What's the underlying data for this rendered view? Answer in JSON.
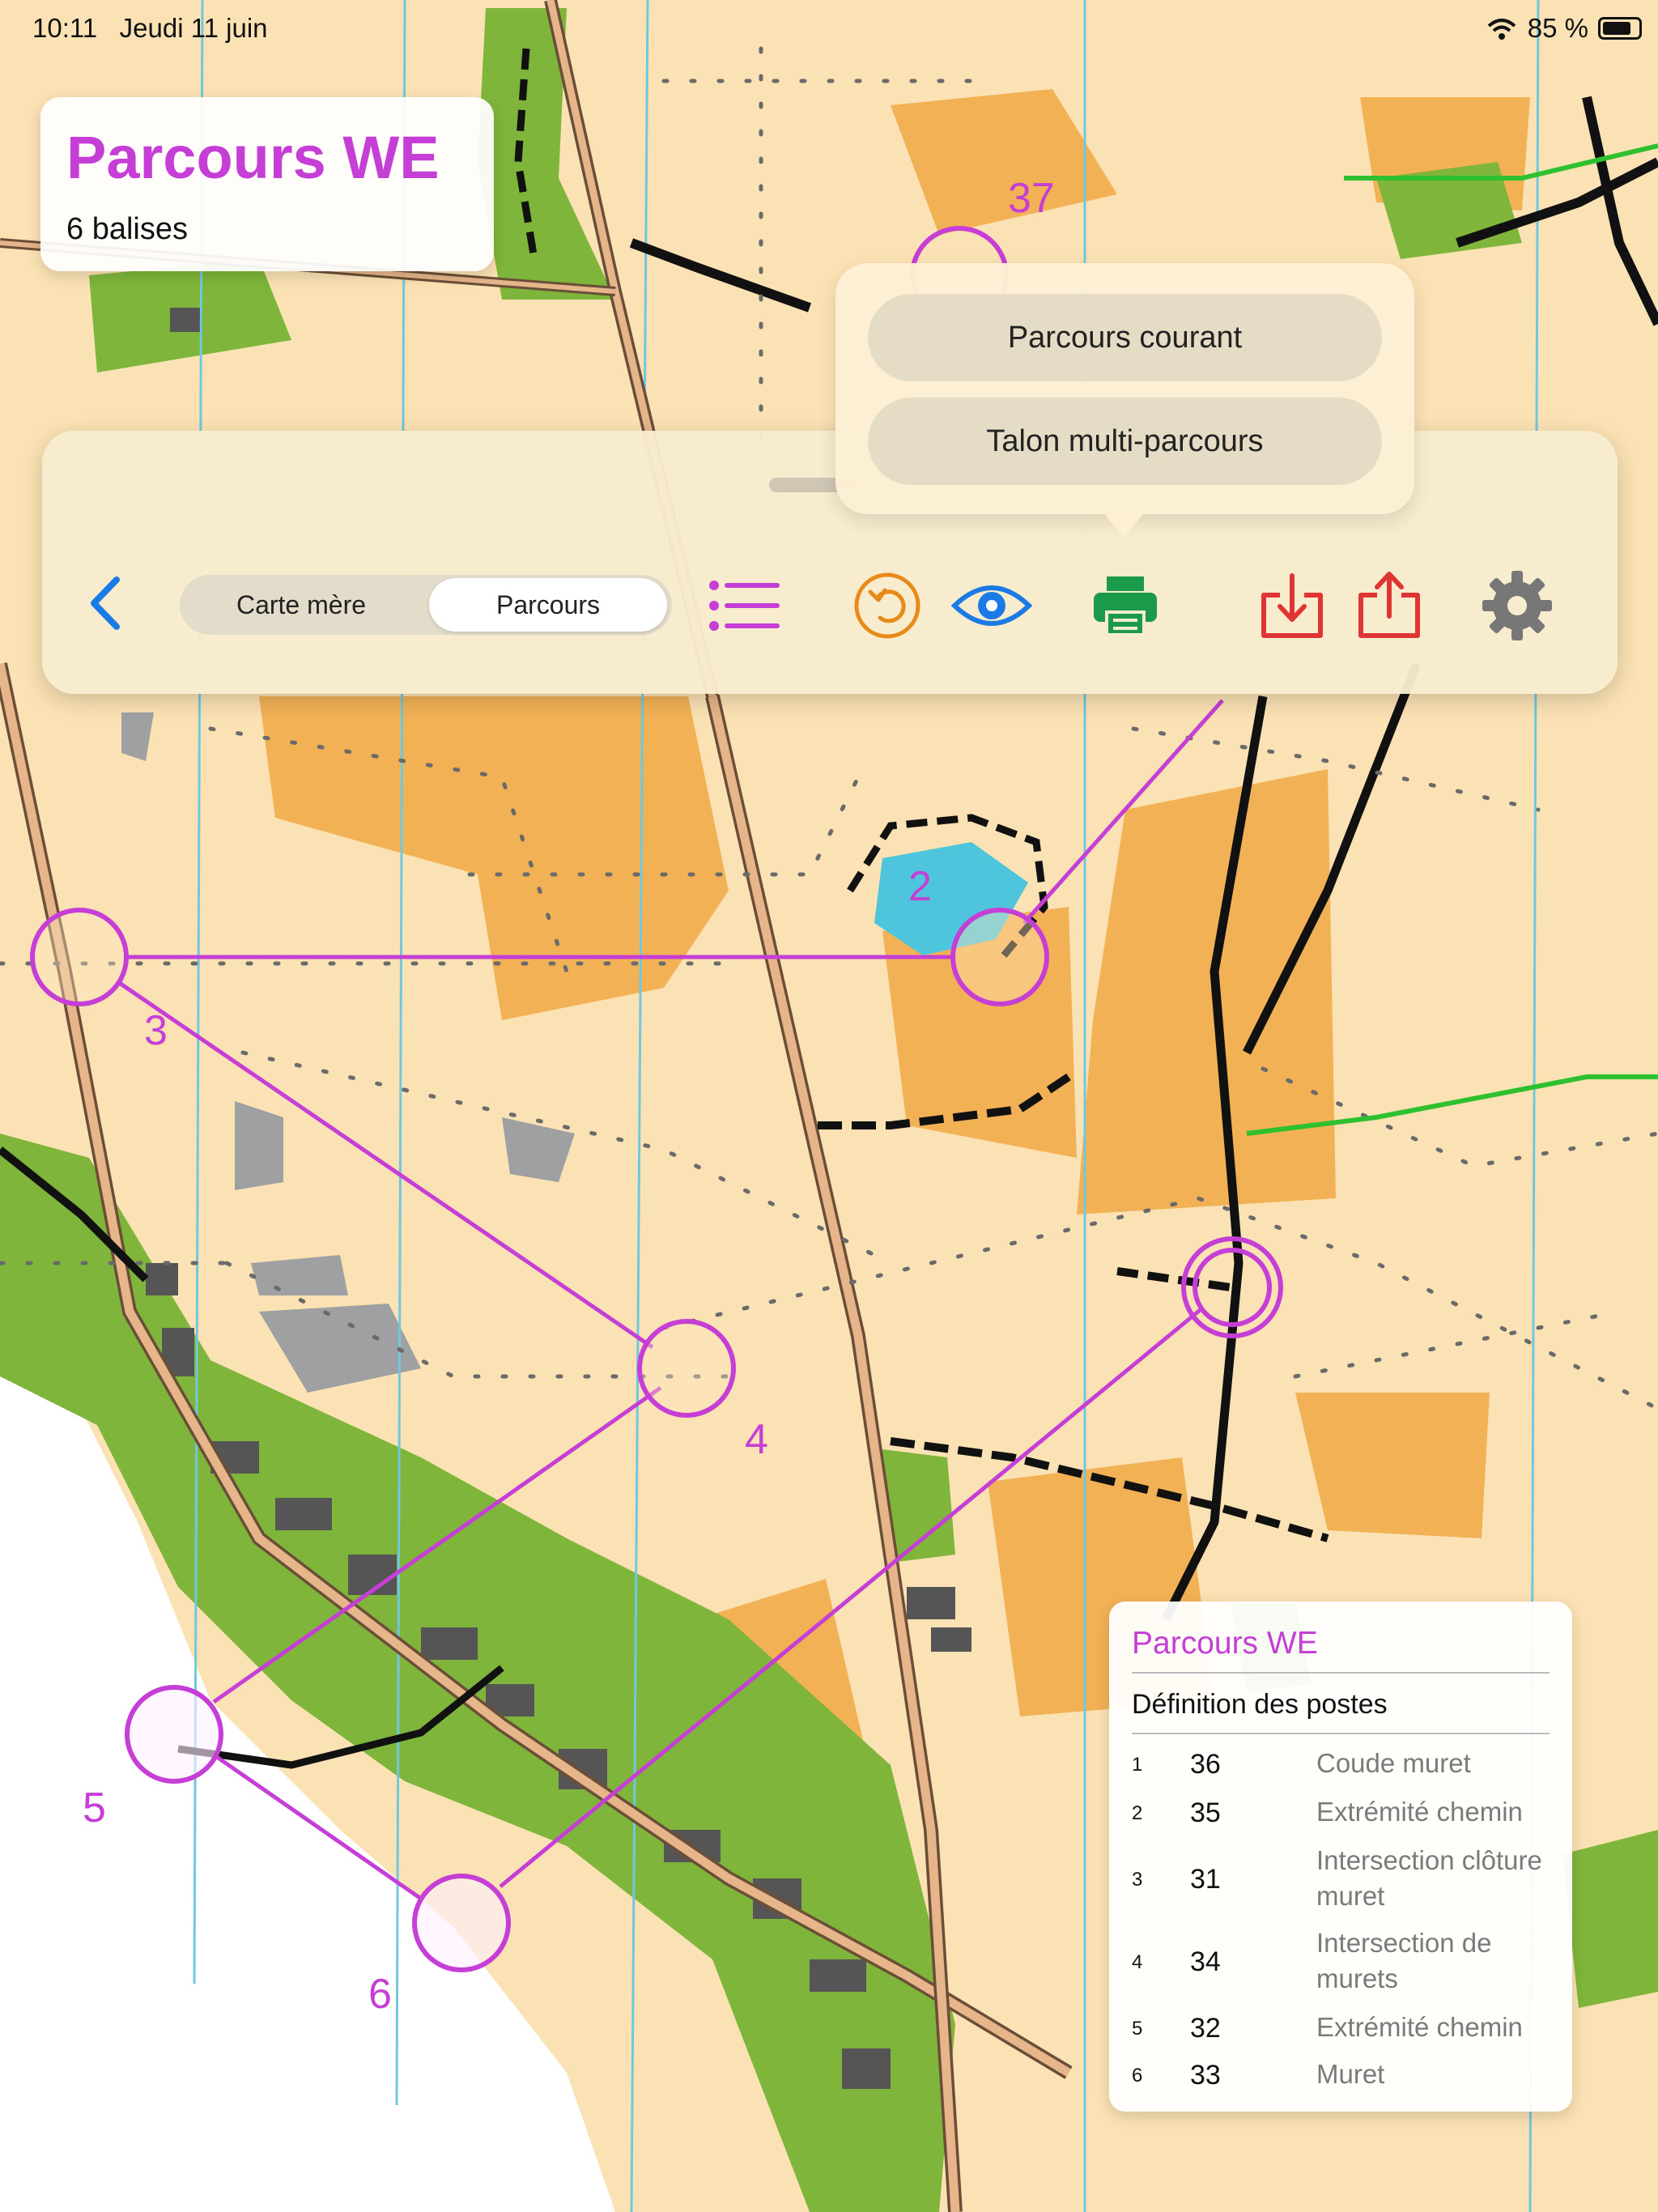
{
  "status_bar": {
    "time": "10:11",
    "date": "Jeudi 11 juin",
    "battery": "85 %"
  },
  "course_card": {
    "title": "Parcours WE",
    "subtitle": "6 balises"
  },
  "toolbar": {
    "segments": [
      "Carte mère",
      "Parcours"
    ],
    "selected_segment": "Parcours",
    "icons": [
      "back-chevron-icon",
      "list-icon",
      "undo-icon",
      "eye-icon",
      "printer-icon",
      "download-icon",
      "share-icon",
      "gear-icon"
    ]
  },
  "print_menu": {
    "items": [
      "Parcours courant",
      "Talon multi-parcours"
    ]
  },
  "map_labels": {
    "control_2": "2",
    "control_3": "3",
    "control_4": "4",
    "control_5": "5",
    "control_6": "6",
    "control_37": "37"
  },
  "legend": {
    "title": "Parcours WE",
    "heading": "Définition des postes",
    "rows": [
      {
        "num": "1",
        "code": "36",
        "desc": "Coude muret"
      },
      {
        "num": "2",
        "code": "35",
        "desc": "Extrémité chemin"
      },
      {
        "num": "3",
        "code": "31",
        "desc": "Intersection clôture muret"
      },
      {
        "num": "4",
        "code": "34",
        "desc": "Intersection de murets"
      },
      {
        "num": "5",
        "code": "32",
        "desc": "Extrémité chemin"
      },
      {
        "num": "6",
        "code": "33",
        "desc": "Muret"
      }
    ]
  },
  "colors": {
    "course": "#c53ed6",
    "accent_blue": "#1a7ae6",
    "print_green": "#1a9a4a",
    "undo_orange": "#e88a1a",
    "io_red": "#e03535",
    "gear_gray": "#777777"
  }
}
